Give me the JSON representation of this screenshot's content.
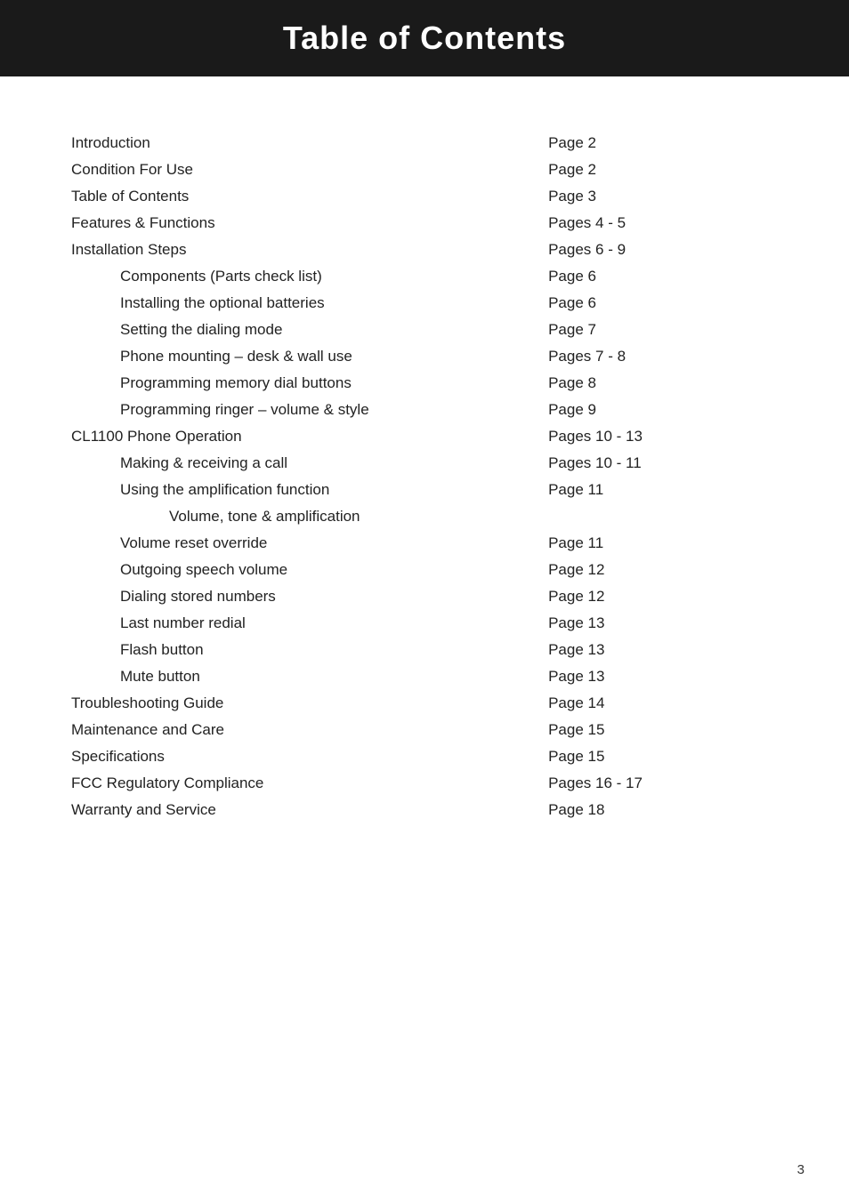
{
  "header": {
    "title": "Table of Contents"
  },
  "toc": {
    "items": [
      {
        "id": "introduction",
        "label": "Introduction",
        "page": "Page 2",
        "indent": 0
      },
      {
        "id": "condition-for-use",
        "label": "Condition For Use",
        "page": "Page 2",
        "indent": 0
      },
      {
        "id": "table-of-contents",
        "label": "Table of Contents",
        "page": "Page 3",
        "indent": 0
      },
      {
        "id": "features-functions",
        "label": "Features & Functions",
        "page": "Pages 4 - 5",
        "indent": 0
      },
      {
        "id": "installation-steps",
        "label": "Installation Steps",
        "page": "Pages 6 - 9",
        "indent": 0
      },
      {
        "id": "components",
        "label": "Components (Parts check list)",
        "page": "Page 6",
        "indent": 1
      },
      {
        "id": "installing-batteries",
        "label": "Installing the optional batteries",
        "page": "Page 6",
        "indent": 1
      },
      {
        "id": "setting-dialing-mode",
        "label": "Setting the dialing mode",
        "page": "Page 7",
        "indent": 1
      },
      {
        "id": "phone-mounting",
        "label": "Phone mounting – desk & wall use",
        "page": "Pages 7 - 8",
        "indent": 1
      },
      {
        "id": "programming-memory",
        "label": "Programming memory dial buttons",
        "page": "Page 8",
        "indent": 1
      },
      {
        "id": "programming-ringer",
        "label": "Programming ringer – volume & style",
        "page": "Page 9",
        "indent": 1
      },
      {
        "id": "cl1100-operation",
        "label": "CL1100 Phone Operation",
        "page": "Pages 10 - 13",
        "indent": 0
      },
      {
        "id": "making-receiving",
        "label": "Making & receiving a call",
        "page": "Pages 10 - 11",
        "indent": 1
      },
      {
        "id": "amplification-function",
        "label": "Using the amplification function",
        "page": "Page 11",
        "indent": 1
      },
      {
        "id": "volume-tone",
        "label": "Volume, tone & amplification",
        "page": "",
        "indent": 2
      },
      {
        "id": "volume-reset",
        "label": "Volume reset override",
        "page": "Page 11",
        "indent": 1
      },
      {
        "id": "outgoing-speech",
        "label": "Outgoing speech volume",
        "page": "Page 12",
        "indent": 1
      },
      {
        "id": "dialing-stored",
        "label": "Dialing stored numbers",
        "page": "Page 12",
        "indent": 1
      },
      {
        "id": "last-number-redial",
        "label": "Last number redial",
        "page": "Page 13",
        "indent": 1
      },
      {
        "id": "flash-button",
        "label": "Flash button",
        "page": "Page 13",
        "indent": 1
      },
      {
        "id": "mute-button",
        "label": "Mute button",
        "page": "Page 13",
        "indent": 1
      },
      {
        "id": "troubleshooting",
        "label": "Troubleshooting Guide",
        "page": "Page 14",
        "indent": 0
      },
      {
        "id": "maintenance",
        "label": "Maintenance and Care",
        "page": "Page 15",
        "indent": 0
      },
      {
        "id": "specifications",
        "label": "Specifications",
        "page": "Page 15",
        "indent": 0
      },
      {
        "id": "fcc-compliance",
        "label": "FCC Regulatory Compliance",
        "page": "Pages 16 - 17",
        "indent": 0
      },
      {
        "id": "warranty",
        "label": "Warranty and Service",
        "page": "Page 18",
        "indent": 0
      }
    ]
  },
  "footer": {
    "page_number": "3"
  }
}
